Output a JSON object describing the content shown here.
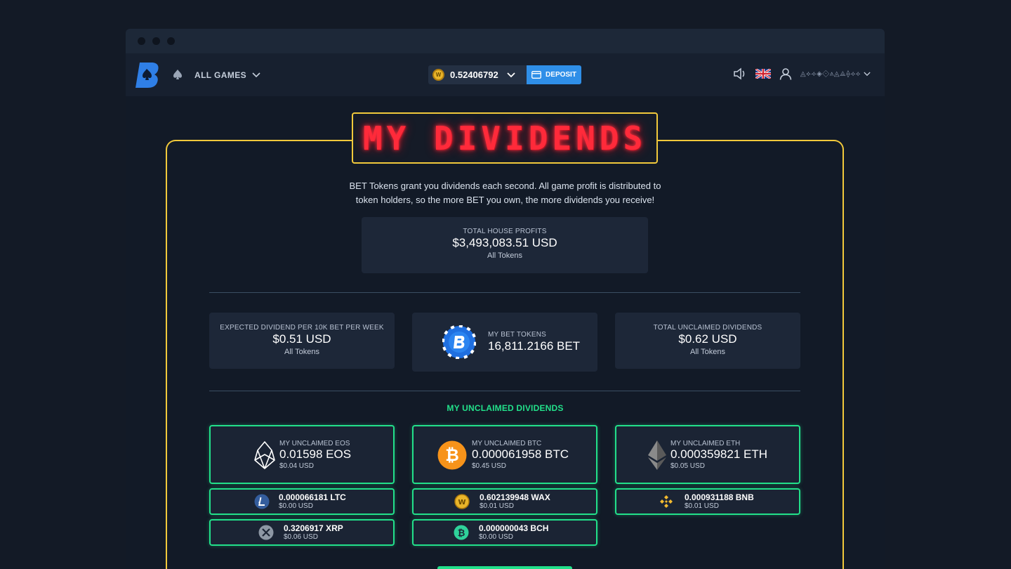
{
  "nav": {
    "all_games": "ALL GAMES",
    "balance": "0.52406792",
    "deposit": "DEPOSIT",
    "username": "◬⟡⟢◈⟐⟑◬⟁⟠⟢⟡"
  },
  "page": {
    "title": "MY DIVIDENDS",
    "intro_line1": "BET Tokens grant you dividends each second. All game profit is distributed to",
    "intro_line2": "token holders, so the more BET you own, the more dividends you receive!"
  },
  "house": {
    "label": "TOTAL HOUSE PROFITS",
    "value": "$3,493,083.51 USD",
    "sub": "All Tokens"
  },
  "stats": {
    "expected": {
      "label": "EXPECTED DIVIDEND PER 10K BET PER WEEK",
      "value": "$0.51 USD",
      "sub": "All Tokens"
    },
    "tokens": {
      "label": "MY BET TOKENS",
      "value": "16,811.2166 BET"
    },
    "unclaimed": {
      "label": "TOTAL UNCLAIMED DIVIDENDS",
      "value": "$0.62 USD",
      "sub": "All Tokens"
    }
  },
  "unclaimed_title": "MY UNCLAIMED DIVIDENDS",
  "big": [
    {
      "label": "MY UNCLAIMED EOS",
      "value": "0.01598 EOS",
      "usd": "$0.04 USD",
      "icon": "eos-icon"
    },
    {
      "label": "MY UNCLAIMED BTC",
      "value": "0.000061958 BTC",
      "usd": "$0.45 USD",
      "icon": "btc-icon"
    },
    {
      "label": "MY UNCLAIMED ETH",
      "value": "0.000359821 ETH",
      "usd": "$0.05 USD",
      "icon": "eth-icon"
    }
  ],
  "small": [
    {
      "value": "0.000066181 LTC",
      "usd": "$0.00 USD",
      "icon": "ltc-icon"
    },
    {
      "value": "0.602139948 WAX",
      "usd": "$0.01 USD",
      "icon": "wax-icon"
    },
    {
      "value": "0.000931188 BNB",
      "usd": "$0.01 USD",
      "icon": "bnb-icon"
    },
    {
      "value": "0.3206917 XRP",
      "usd": "$0.06 USD",
      "icon": "xrp-icon"
    },
    {
      "value": "0.000000043 BCH",
      "usd": "$0.00 USD",
      "icon": "bch-icon"
    }
  ],
  "colors": {
    "accent_green": "#22e08a",
    "gold_border": "#f1c93b",
    "deposit_blue": "#2f8fe8",
    "marquee_red": "#ff2a3a"
  }
}
